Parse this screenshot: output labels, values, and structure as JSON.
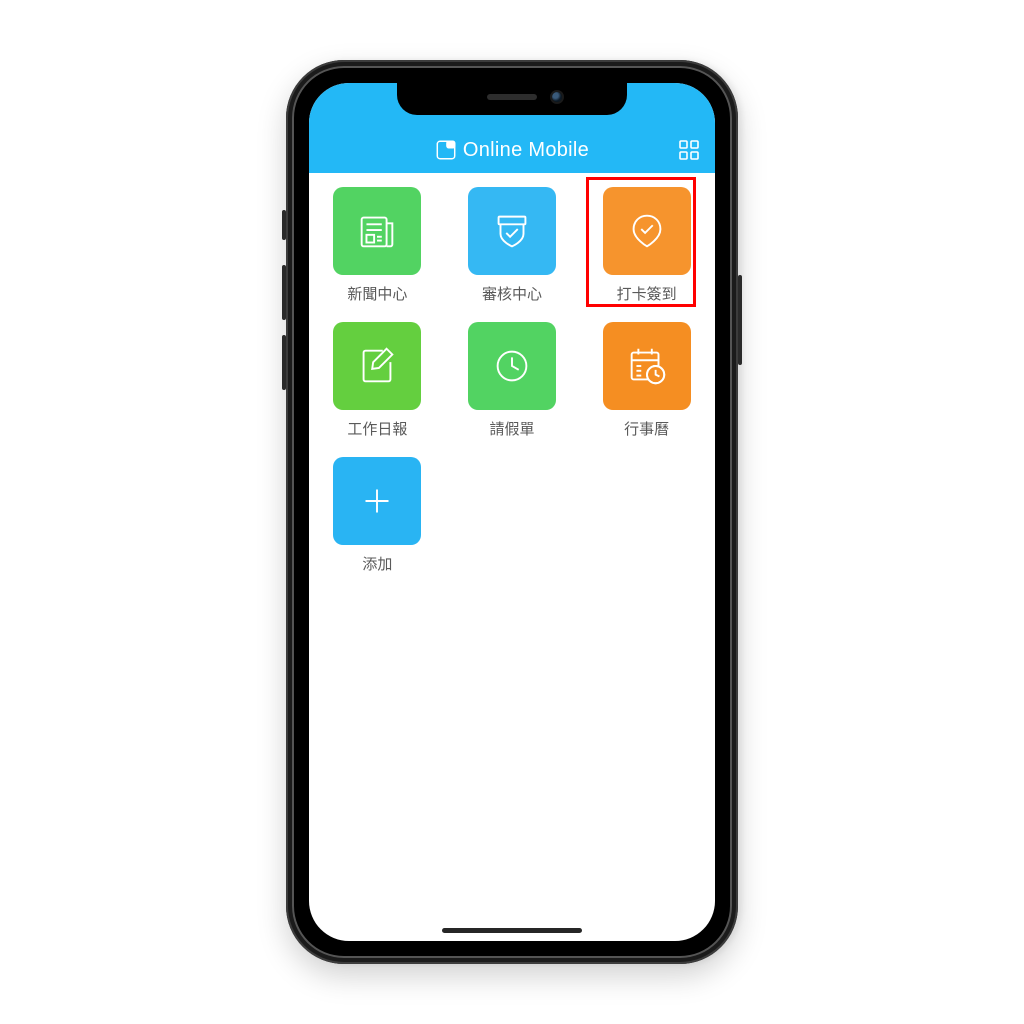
{
  "header": {
    "title": "Online Mobile"
  },
  "apps": [
    {
      "label": "新聞中心"
    },
    {
      "label": "審核中心"
    },
    {
      "label": "打卡簽到"
    },
    {
      "label": "工作日報"
    },
    {
      "label": "請假單"
    },
    {
      "label": "行事曆"
    },
    {
      "label": "添加"
    }
  ],
  "highlight": {
    "index": 2
  },
  "colors": {
    "accent_blue": "#23b8f6",
    "tile_green": "#52d362",
    "tile_blue": "#35b8f3",
    "tile_orange": "#f6942d",
    "highlight_red": "#ff0000"
  }
}
